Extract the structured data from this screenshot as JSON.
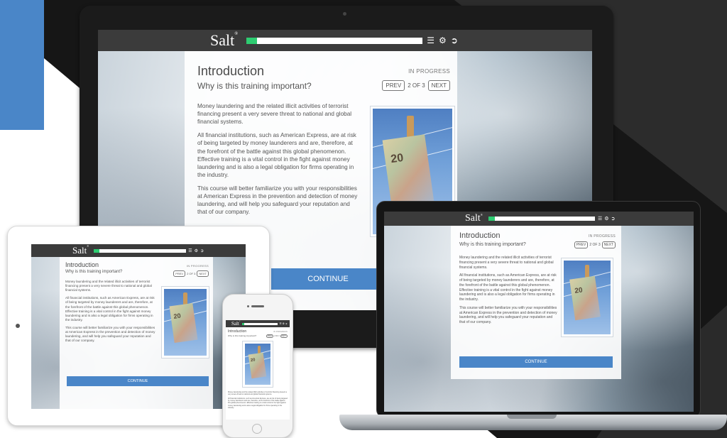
{
  "brand": {
    "logo": "Salt",
    "trademark": "®",
    "accent_color": "#2ecc71",
    "button_color": "#4a86c8",
    "topbar_color": "#3b3b3b"
  },
  "toolbar": {
    "menu_icon": "menu-icon",
    "settings_icon": "gear-icon",
    "exit_icon": "exit-icon",
    "progress": 0.06
  },
  "lesson": {
    "title": "Introduction",
    "subtitle": "Why is this training important?",
    "status": "IN PROGRESS",
    "prev_label": "PREV",
    "page_indicator": "2 OF 3",
    "next_label": "NEXT",
    "paragraphs": [
      "Money laundering and the related illicit activities of terrorist financing present a very severe threat to national and global financial systems.",
      "All financial institutions, such as American Express, are at risk of being targeted by money launderers and are, therefore, at the forefront of the battle against this global phenomenon. Effective training is a vital control in the fight against money laundering and is also a legal obligation for firms operating in the industry.",
      "This course will better familiarize you with your responsibilities at American Express in the prevention and detection of money laundering, and will help you safeguard your reputation and that of our company."
    ],
    "continue_label": "CONTINUE",
    "image_alt": "euro banknote pinned on clothes line",
    "note_value": "20"
  }
}
